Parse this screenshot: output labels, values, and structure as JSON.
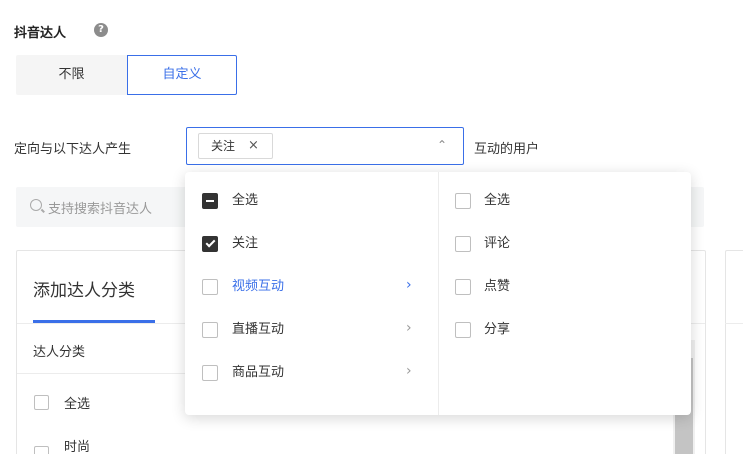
{
  "section": {
    "title": "抖音达人",
    "help_icon": "question-circle-icon"
  },
  "segmented": {
    "unlimited": "不限",
    "custom": "自定义",
    "selected": "自定义"
  },
  "target": {
    "prefix": "定向与以下达人产生",
    "suffix": "互动的用户",
    "selected_tag": "关注",
    "tag_close": "×",
    "chevron": "⌃"
  },
  "search": {
    "placeholder": "支持搜索抖音达人"
  },
  "left_panel": {
    "tab": "添加达人分类",
    "column_header": "达人分类",
    "items": [
      {
        "label": "全选",
        "checked": false
      },
      {
        "label": "时尚",
        "checked": false
      }
    ]
  },
  "dropdown": {
    "left_items": [
      {
        "label": "全选",
        "state": "indeterminate",
        "has_submenu": false
      },
      {
        "label": "关注",
        "state": "checked",
        "has_submenu": false
      },
      {
        "label": "视频互动",
        "state": "unchecked",
        "has_submenu": true,
        "active": true
      },
      {
        "label": "直播互动",
        "state": "unchecked",
        "has_submenu": true
      },
      {
        "label": "商品互动",
        "state": "unchecked",
        "has_submenu": true
      }
    ],
    "right_items": [
      {
        "label": "全选",
        "state": "unchecked"
      },
      {
        "label": "评论",
        "state": "unchecked"
      },
      {
        "label": "点赞",
        "state": "unchecked"
      },
      {
        "label": "分享",
        "state": "unchecked"
      }
    ],
    "submenu_chevron": "›"
  },
  "colors": {
    "accent": "#3a6fe8",
    "text": "#333333",
    "muted": "#999999"
  }
}
